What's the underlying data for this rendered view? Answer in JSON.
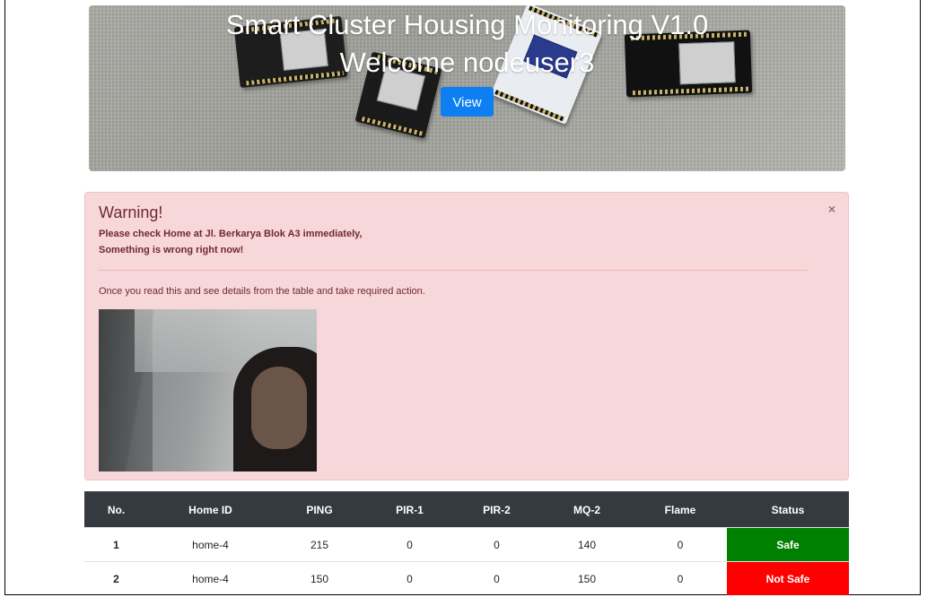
{
  "hero": {
    "title": "Smart Cluster Housing Monitoring V1.0",
    "welcome": "Welcome nodeuser3",
    "view_button": "View"
  },
  "alert": {
    "heading": "Warning!",
    "close_icon": "×",
    "message_line1": "Please check Home at Jl. Berkarya Blok A3 immediately,",
    "message_line2": "Something is wrong right now!",
    "note": "Once you read this and see details from the table and take required action.",
    "camera_icon": "camera-snapshot"
  },
  "table": {
    "headers": [
      "No.",
      "Home ID",
      "PING",
      "PIR-1",
      "PIR-2",
      "MQ-2",
      "Flame",
      "Status"
    ],
    "rows": [
      {
        "no": "1",
        "home_id": "home-4",
        "ping": "215",
        "pir1": "0",
        "pir2": "0",
        "mq2": "140",
        "flame": "0",
        "status": "Safe",
        "status_color": "#008000"
      },
      {
        "no": "2",
        "home_id": "home-4",
        "ping": "150",
        "pir1": "0",
        "pir2": "0",
        "mq2": "150",
        "flame": "0",
        "status": "Not Safe",
        "status_color": "#ff0000"
      }
    ]
  },
  "colors": {
    "accent": "#0d7ff2",
    "alert_bg": "#f8d7da",
    "table_header": "#343a40",
    "safe": "#008000",
    "not_safe": "#ff0000"
  }
}
